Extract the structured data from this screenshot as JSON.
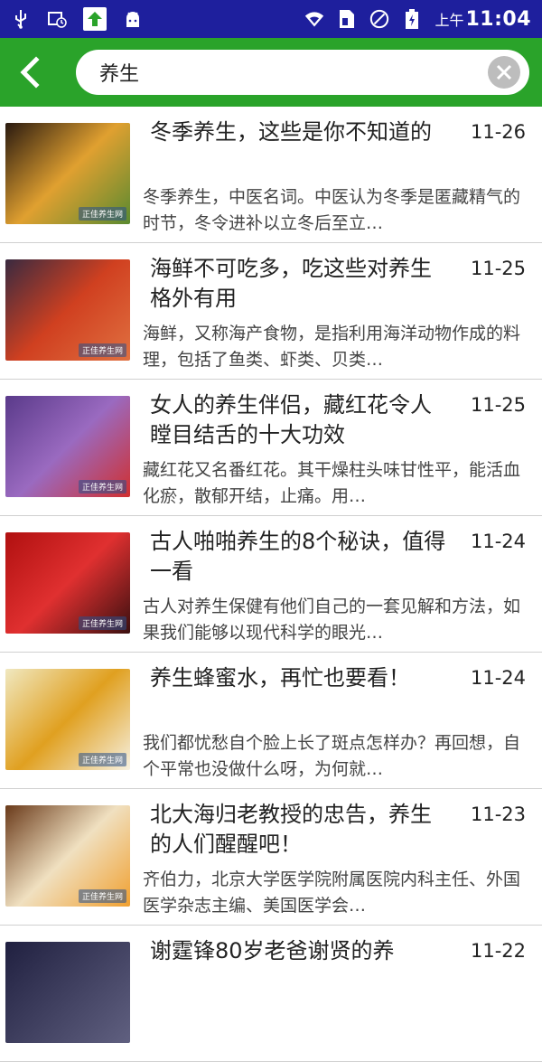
{
  "status": {
    "ampm": "上午",
    "time": "11:04"
  },
  "search": {
    "query": "养生"
  },
  "items": [
    {
      "title": "冬季养生，这些是你不知道的",
      "date": "11-26",
      "desc": "冬季养生，中医名词。中医认为冬季是匿藏精气的时节，冬令进补以立冬后至立…",
      "thumb_colors": [
        "#2a1a10",
        "#e0a030",
        "#5a8a30"
      ],
      "watermark": "正佳养生网"
    },
    {
      "title": "海鲜不可吃多，吃这些对养生格外有用",
      "date": "11-25",
      "desc": "海鲜，又称海产食物，是指利用海洋动物作成的料理，包括了鱼类、虾类、贝类…",
      "thumb_colors": [
        "#3a2a40",
        "#d04020",
        "#e07040"
      ],
      "watermark": "正佳养生网"
    },
    {
      "title": "女人的养生伴侣，藏红花令人瞠目结舌的十大功效",
      "date": "11-25",
      "desc": " 藏红花又名番红花。其干燥柱头味甘性平，能活血化瘀，散郁开结，止痛。用…",
      "thumb_colors": [
        "#5a3a8a",
        "#9a6ac0",
        "#d03030"
      ],
      "watermark": "正佳养生网"
    },
    {
      "title": "古人啪啪养生的8个秘诀，值得一看",
      "date": "11-24",
      "desc": "古人对养生保健有他们自己的一套见解和方法，如果我们能够以现代科学的眼光…",
      "thumb_colors": [
        "#b01010",
        "#e03030",
        "#3a1010"
      ],
      "watermark": "正佳养生网"
    },
    {
      "title": "养生蜂蜜水，再忙也要看！",
      "date": "11-24",
      "desc": "我们都忧愁自个脸上长了斑点怎样办？再回想，自个平常也没做什么呀，为何就…",
      "thumb_colors": [
        "#f0e8c0",
        "#e0a020",
        "#f6f0e0"
      ],
      "watermark": "正佳养生网"
    },
    {
      "title": "北大海归老教授的忠告，养生的人们醒醒吧！",
      "date": "11-23",
      "desc": "齐伯力，北京大学医学院附属医院内科主任、外国医学杂志主编、美国医学会…",
      "thumb_colors": [
        "#6a3a1a",
        "#f0e0c0",
        "#f0a030"
      ],
      "watermark": "正佳养生网"
    },
    {
      "title": "谢霆锋80岁老爸谢贤的养",
      "date": "11-22",
      "desc": "",
      "thumb_colors": [
        "#202040",
        "#404060",
        "#606080"
      ],
      "watermark": ""
    }
  ]
}
